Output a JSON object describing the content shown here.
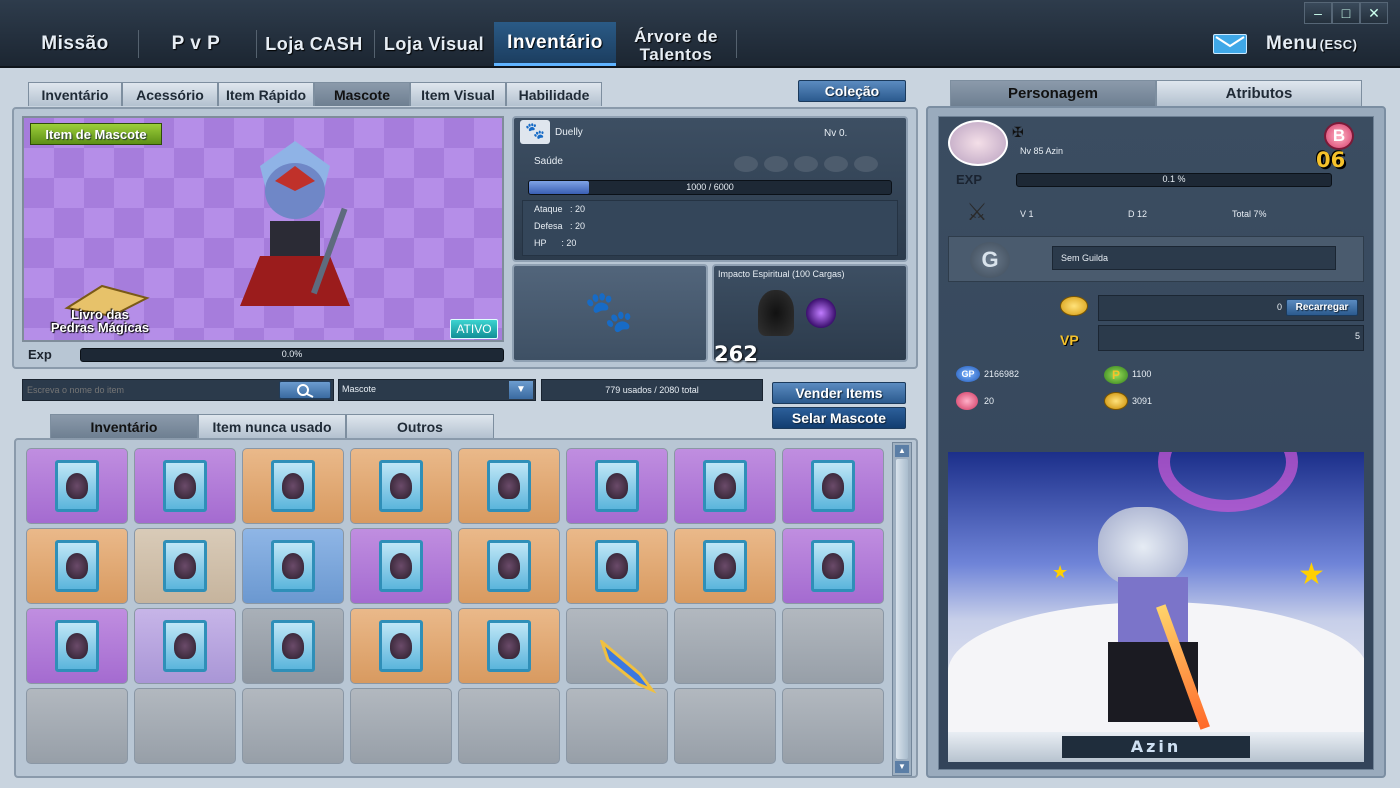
{
  "nav": {
    "items": [
      "Missão",
      "P v P",
      "Loja CASH",
      "Loja Visual",
      "Inventário",
      "Árvore de Talentos"
    ],
    "menu_label": "Menu",
    "menu_hint": "(ESC)",
    "window_buttons": [
      "–",
      "□",
      "✕"
    ]
  },
  "left_tabs": [
    "Inventário",
    "Acessório",
    "Item Rápido",
    "Mascote",
    "Item Visual",
    "Habilidade"
  ],
  "colecao_button": "Coleção",
  "pet": {
    "badge": "Item de Mascote",
    "book_label_1": "Livro das",
    "book_label_2": "Pedras Mágicas",
    "status": "ATIVO",
    "exp_label": "Exp",
    "exp_text": "0.0%",
    "exp_fraction": 0.0,
    "name": "Duelly",
    "level": "Nv 0.",
    "health_label": "Saúde",
    "health_text": "1000 / 6000",
    "health_fraction": 0.1667,
    "stats": [
      "Ataque   : 20",
      "Defesa   : 20",
      "HP      : 20"
    ],
    "skill_name": "Impacto Espiritual (100 Cargas)",
    "skill_value": "262"
  },
  "search": {
    "placeholder": "Escreva o nome do item",
    "category": "Mascote",
    "usage": "779 usados / 2080 total"
  },
  "buttons": {
    "sell": "Vender Items",
    "seal": "Selar Mascote"
  },
  "inv_tabs": [
    "Inventário",
    "Item nunca usado",
    "Outros"
  ],
  "slots": [
    "purple",
    "purple",
    "orange",
    "orange",
    "orange",
    "purple",
    "purple",
    "purple",
    "orange",
    "beige",
    "blue",
    "purple",
    "orange",
    "orange",
    "orange",
    "purple",
    "purple",
    "lav",
    "gray",
    "orange",
    "orange",
    "empty",
    "empty",
    "empty",
    "empty",
    "empty",
    "empty",
    "empty",
    "empty",
    "empty",
    "empty",
    "empty"
  ],
  "right_tabs": [
    "Personagem",
    "Atributos"
  ],
  "character": {
    "level_name": "Nv 85 Azin",
    "rank_letter": "B",
    "rank_number": "06",
    "exp_label": "EXP",
    "exp_text": "0.1 %",
    "record_v": "V 1",
    "record_d": "D 12",
    "record_total": "Total 7%",
    "guild": "Sem Guilda",
    "cash": "0",
    "recharge": "Recarregar",
    "vp_label": "VP",
    "vp": "5",
    "gp_label": "GP",
    "gp": "2166982",
    "p_value": "1100",
    "gem_value": "20",
    "coin_value": "3091",
    "name": "Azin"
  }
}
